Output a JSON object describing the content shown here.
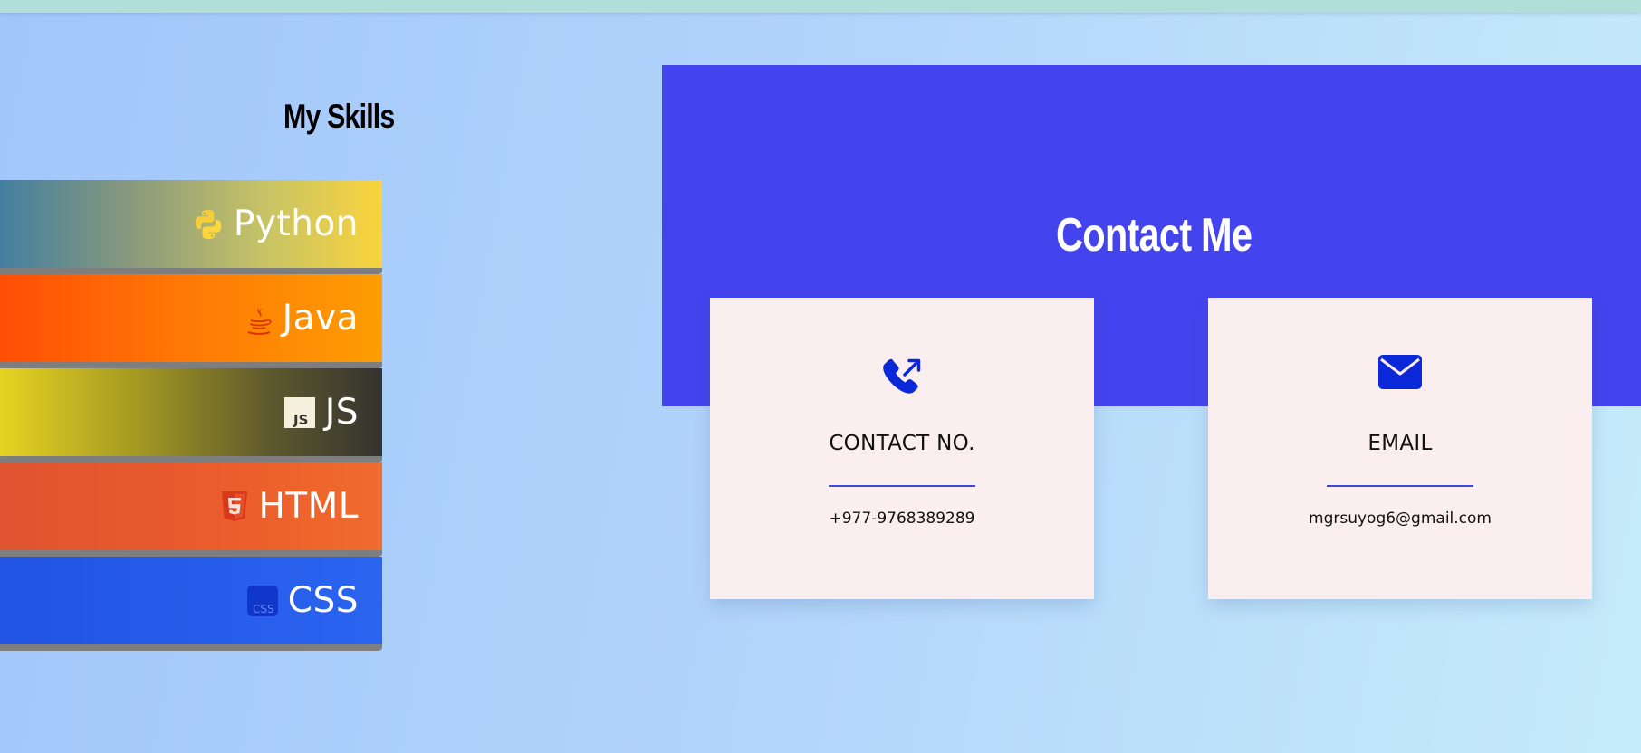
{
  "skills": {
    "title": "My Skills",
    "items": [
      {
        "label": "Python",
        "icon": "python-icon"
      },
      {
        "label": "Java",
        "icon": "java-icon"
      },
      {
        "label": "JS",
        "icon": "js-icon"
      },
      {
        "label": "HTML",
        "icon": "html5-icon"
      },
      {
        "label": "CSS",
        "icon": "css-icon"
      }
    ]
  },
  "contact": {
    "title": "Contact Me",
    "cards": [
      {
        "heading": "CONTACT NO.",
        "value": "+977-9768389289",
        "icon": "phone-outgoing-icon"
      },
      {
        "heading": "EMAIL",
        "value": "mgrsuyog6@gmail.com",
        "icon": "envelope-icon"
      }
    ]
  },
  "colors": {
    "banner": "#4444ee",
    "card": "#faeeee",
    "accent": "#0a28d8"
  }
}
